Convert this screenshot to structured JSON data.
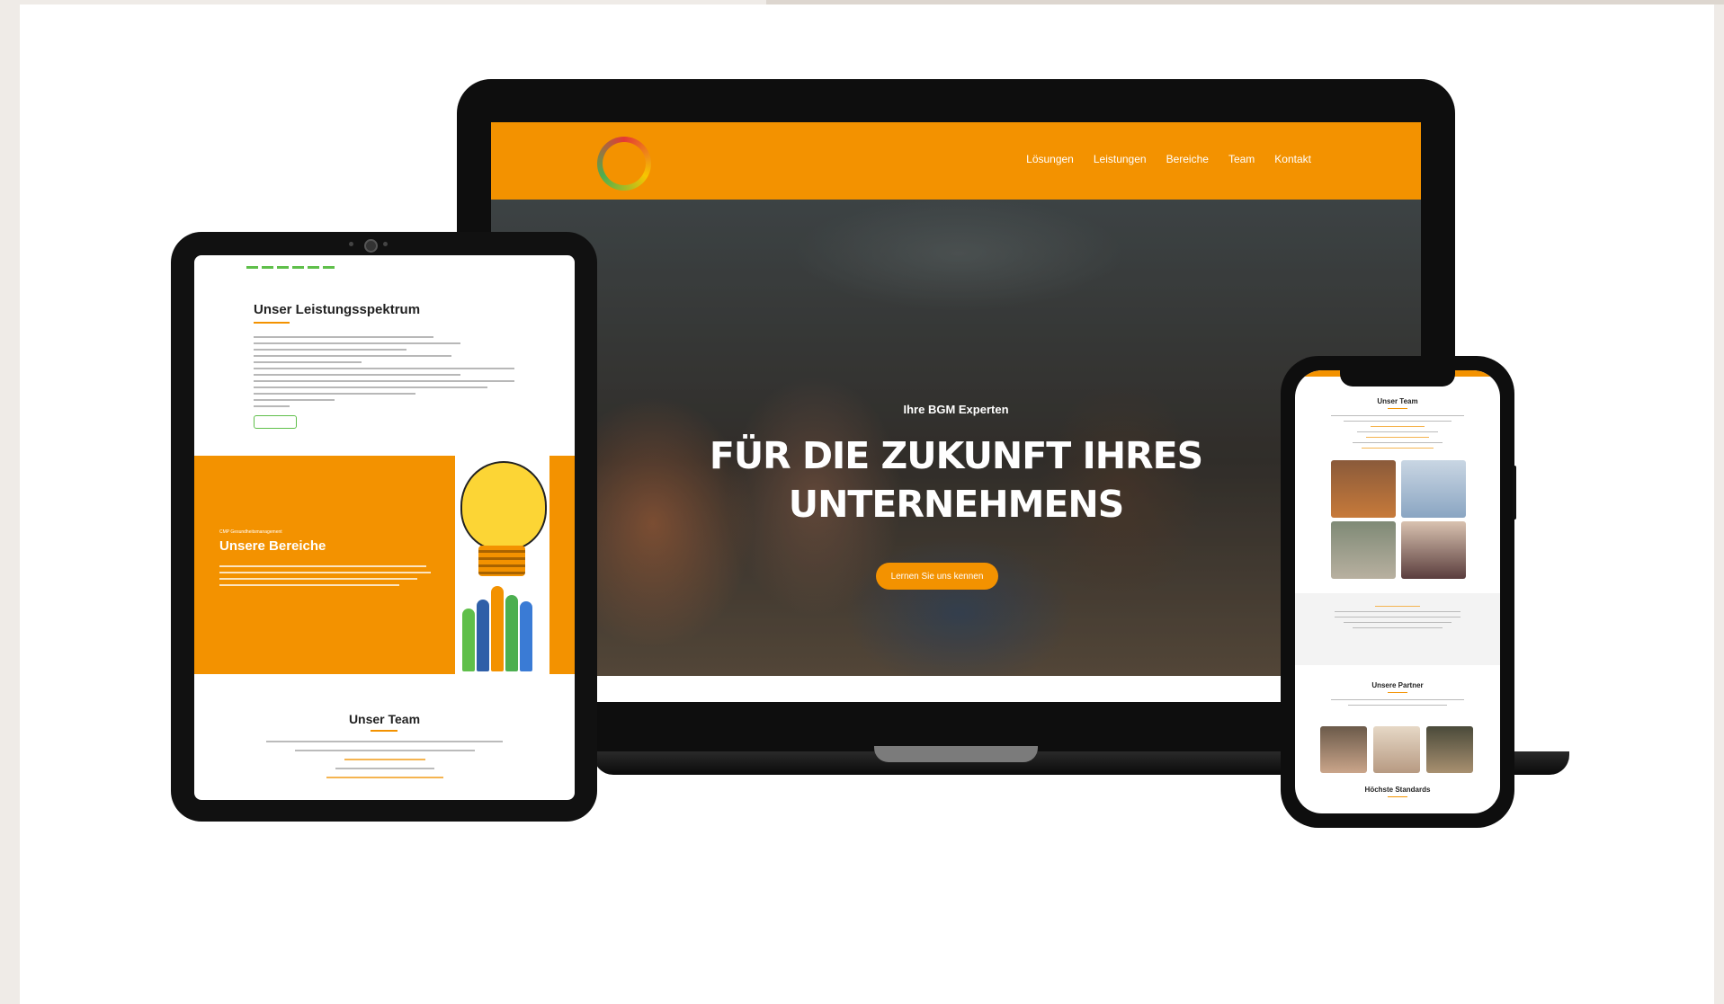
{
  "colors": {
    "brand_orange": "#f39200",
    "accent_green": "#5fbf4a",
    "frame_black": "#0e0e0e",
    "backdrop": "#efebe7"
  },
  "laptop": {
    "logo": "logo-ring-icon",
    "nav": [
      "Lösungen",
      "Leistungen",
      "Bereiche",
      "Team",
      "Kontakt"
    ],
    "hero": {
      "kicker": "Ihre BGM Experten",
      "title_line1": "FÜR DIE ZUKUNFT IHRES",
      "title_line2": "UNTERNEHMENS",
      "cta": "Lernen Sie uns kennen"
    }
  },
  "tablet": {
    "section1_title": "Unser Leistungsspektrum",
    "section2_kicker": "CMP Gesundheitsmanagement",
    "section2_title": "Unsere Bereiche",
    "section3_title": "Unser Team"
  },
  "phone": {
    "section1_title": "Unser Team",
    "section2_title": "Unsere Partner",
    "section3_title": "Höchste Standards"
  }
}
